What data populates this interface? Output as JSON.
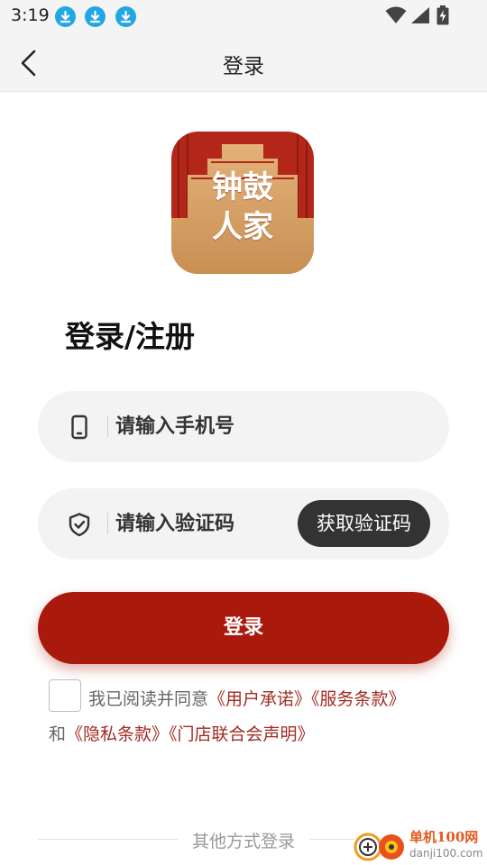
{
  "status_bar": {
    "time": "3:19",
    "icons": [
      "download-icon",
      "download-icon",
      "download-icon",
      "wifi-icon",
      "signal-icon",
      "battery-charging-icon"
    ]
  },
  "header": {
    "title": "登录",
    "back_icon": "chevron-left-icon"
  },
  "logo": {
    "text_top": "钟鼓",
    "text_bottom": "人家"
  },
  "heading": "登录/注册",
  "phone_field": {
    "icon": "phone-icon",
    "placeholder": "请输入手机号"
  },
  "code_field": {
    "icon": "shield-check-icon",
    "placeholder": "请输入验证码",
    "get_code_label": "获取验证码"
  },
  "login_button_label": "登录",
  "agreement": {
    "prefix": "我已阅读并同意",
    "link_user_promise": "《用户承诺》",
    "link_terms": "《服务条款》",
    "connector": "和",
    "link_privacy": "《隐私条款》",
    "link_store_statement": "《门店联合会声明》"
  },
  "other_login_label": "其他方式登录",
  "watermark": {
    "name": "单机100网",
    "url": "danji100.com"
  },
  "colors": {
    "accent": "#a9190c",
    "link": "#a12b22",
    "dark_button": "#333333",
    "status_download": "#22a7e5"
  }
}
